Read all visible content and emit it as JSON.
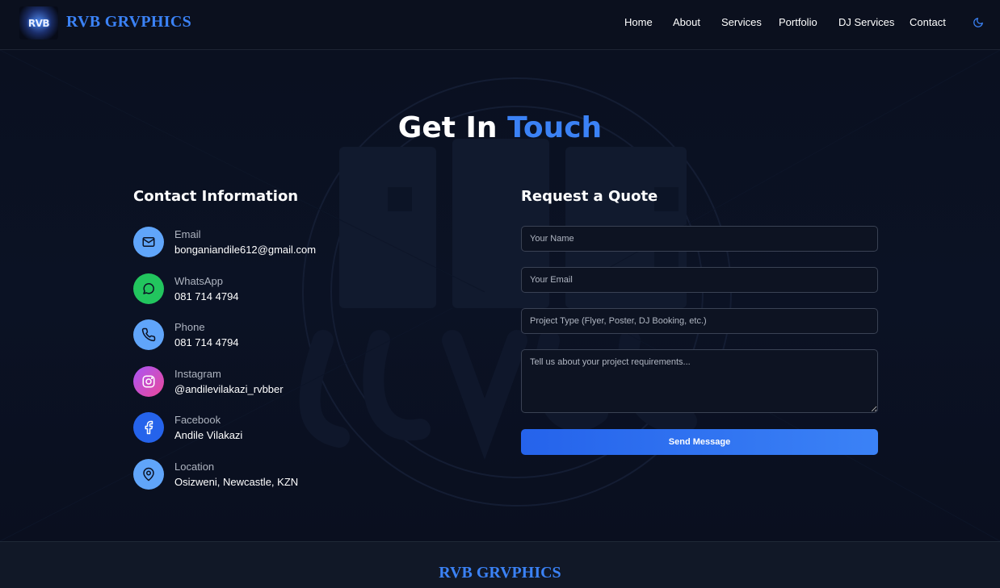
{
  "header": {
    "logo_alt": "RVB GRVPHICS logo",
    "logo_text": "RVB",
    "brand": "RVB GRVPHICS",
    "nav": [
      "Home",
      "About",
      "Services",
      "Portfolio",
      "DJ Services",
      "Contact"
    ],
    "theme_icon": "moon-icon"
  },
  "main": {
    "title_part1": "Get In",
    "title_part2": "Touch",
    "contact_heading": "Contact Information",
    "quote_heading": "Request a Quote",
    "contacts": [
      {
        "label": "Email",
        "value": "bonganiandile612@gmail.com",
        "icon": "mail-icon",
        "color": "#60a5fa"
      },
      {
        "label": "WhatsApp",
        "value": "081 714 4794",
        "icon": "whatsapp-icon",
        "color": "#22c55e"
      },
      {
        "label": "Phone",
        "value": "081 714 4794",
        "icon": "phone-icon",
        "color": "#60a5fa"
      },
      {
        "label": "Instagram",
        "value": "@andilevilakazi_rvbber",
        "icon": "instagram-icon",
        "color": "#d946ef"
      },
      {
        "label": "Facebook",
        "value": "Andile Vilakazi",
        "icon": "facebook-icon",
        "color": "#2563eb"
      },
      {
        "label": "Location",
        "value": "Osizweni, Newcastle, KZN",
        "icon": "location-pin-icon",
        "color": "#60a5fa"
      }
    ],
    "form": {
      "name_placeholder": "Your Name",
      "email_placeholder": "Your Email",
      "project_type_placeholder": "Project Type (Flyer, Poster, DJ Booking, etc.)",
      "message_placeholder": "Tell us about your project requirements...",
      "submit_label": "Send Message"
    }
  },
  "footer": {
    "brand": "RVB GRVPHICS"
  },
  "colors": {
    "accent": "#3b82f6",
    "background": "#0a0f1f"
  }
}
